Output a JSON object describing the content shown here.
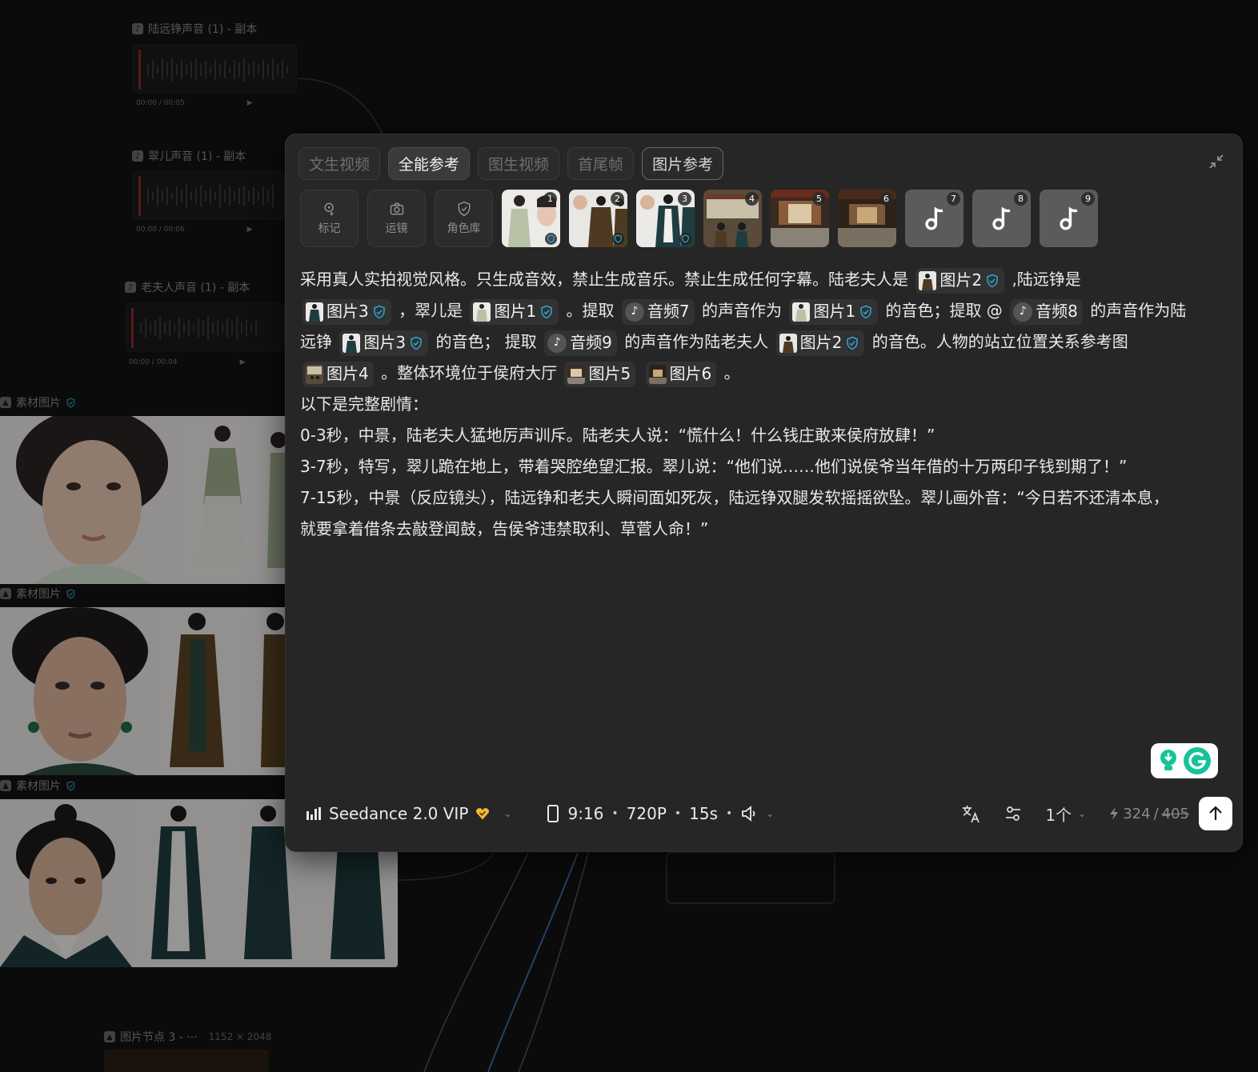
{
  "canvas": {
    "audio_nodes": [
      {
        "title": "陆远铮声音 (1) - 副本",
        "time": "00:00 / 00:05"
      },
      {
        "title": "翠儿声音 (1) - 副本",
        "time": "00:00 / 00:06"
      },
      {
        "title": "老夫人声音 (1) - 副本",
        "time": "00:00 / 00:04"
      }
    ],
    "image_nodes": [
      {
        "title": "素材图片"
      },
      {
        "title": "素材图片"
      },
      {
        "title": "素材图片"
      }
    ],
    "image_node3": {
      "title": "图片节点 3 - ···",
      "size": "1152 × 2048"
    }
  },
  "panel": {
    "tabs": [
      {
        "label": "文生视频",
        "state": "inactive"
      },
      {
        "label": "全能参考",
        "state": "active"
      },
      {
        "label": "图生视频",
        "state": "inactive"
      },
      {
        "label": "首尾帧",
        "state": "inactive"
      },
      {
        "label": "图片参考",
        "state": "outlined"
      }
    ],
    "tools": [
      {
        "label": "标记",
        "icon": "mark-icon"
      },
      {
        "label": "运镜",
        "icon": "camera-icon"
      },
      {
        "label": "角色库",
        "icon": "shield-icon"
      }
    ],
    "references": [
      {
        "num": "1",
        "kind": "image",
        "verified": true
      },
      {
        "num": "2",
        "kind": "image",
        "verified": true
      },
      {
        "num": "3",
        "kind": "image",
        "verified": true
      },
      {
        "num": "4",
        "kind": "image",
        "verified": false
      },
      {
        "num": "5",
        "kind": "image",
        "verified": false
      },
      {
        "num": "6",
        "kind": "image",
        "verified": false
      },
      {
        "num": "7",
        "kind": "audio",
        "verified": false
      },
      {
        "num": "8",
        "kind": "audio",
        "verified": false
      },
      {
        "num": "9",
        "kind": "audio",
        "verified": false
      }
    ],
    "prompt": {
      "l1a": "采用真人实拍视觉风格。只生成音效，禁止生成音乐。禁止生成任何字幕。陆老夫人是",
      "chip_img2": "图片2",
      "l1b": ",陆远铮是",
      "chip_img3": "图片3",
      "l2a": "，翠儿是",
      "chip_img1": "图片1",
      "l2b": "。提取",
      "chip_aud7": "音频7",
      "l2c": "的声音作为",
      "l2d": "的音色；提取 @",
      "chip_aud8": "音频8",
      "l2e": "的声音作为陆",
      "l3a": "远铮",
      "l3b": "的音色；  提取",
      "chip_aud9": "音频9",
      "l3c": "的声音作为陆老夫人",
      "l3d": "的音色。人物的站立位置关系参考图",
      "chip_img4": "图片4",
      "l4a": "。整体环境位于侯府大厅",
      "chip_img5": "图片5",
      "chip_img6": "图片6",
      "l4b": "。",
      "l5": "以下是完整剧情：",
      "l6": "0-3秒，中景，陆老夫人猛地厉声训斥。陆老夫人说：“慌什么！什么钱庄敢来侯府放肆！”",
      "l7": "3-7秒，特写，翠儿跪在地上，带着哭腔绝望汇报。翠儿说：“他们说……他们说侯爷当年借的十万两印子钱到期了！”",
      "l8": "7-15秒，中景（反应镜头），陆远铮和老夫人瞬间面如死灰，陆远铮双腿发软摇摇欲坠。翠儿画外音：“今日若不还清本息，",
      "l9": "就要拿着借条去敲登闻鼓，告侯爷违禁取利、草菅人命！”",
      "note_glyph": "♪"
    },
    "bottom": {
      "model": "Seedance 2.0 VIP",
      "ratio": "9:16",
      "resolution": "720P",
      "duration": "15s",
      "count": "1个",
      "credits_used": "324",
      "credits_total": "405"
    },
    "colors": {
      "accent_verified": "#2aa8d8",
      "vip": "#f4b73a",
      "grammarly": "#15c39a"
    }
  }
}
